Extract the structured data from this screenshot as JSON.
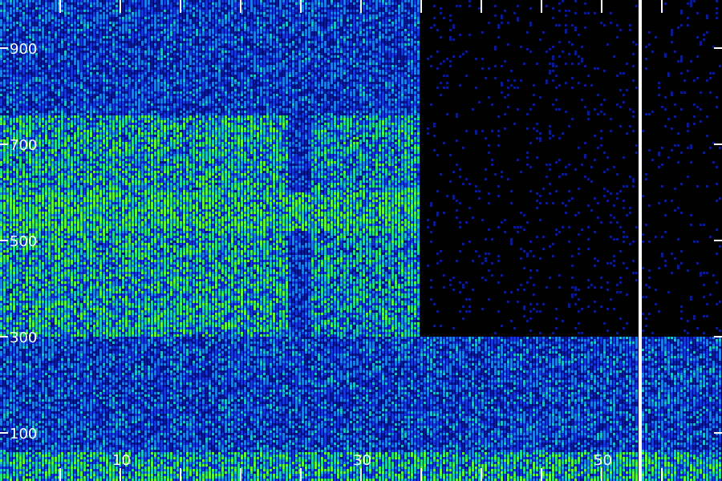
{
  "chart_data": {
    "type": "heatmap",
    "title": "",
    "xlabel": "",
    "ylabel": "",
    "x_ticks": [
      10,
      30,
      50
    ],
    "y_ticks": [
      100,
      300,
      500,
      700,
      900
    ],
    "xlim": [
      0,
      60
    ],
    "ylim": [
      0,
      1000
    ],
    "cursor_x": 53.2,
    "colormap": [
      "#000000",
      "#0a1a8c",
      "#1537d8",
      "#1a7fe6",
      "#19c3c8",
      "#22e07a",
      "#5cff3a"
    ],
    "regions": [
      {
        "x": [
          0,
          24
        ],
        "y": [
          300,
          760
        ],
        "intensity": 0.78
      },
      {
        "x": [
          24,
          26
        ],
        "y": [
          300,
          760
        ],
        "intensity": 0.45
      },
      {
        "x": [
          26,
          35
        ],
        "y": [
          300,
          760
        ],
        "intensity": 0.72
      },
      {
        "x": [
          35.5,
          60
        ],
        "y": [
          305,
          1000
        ],
        "intensity": 0.12
      },
      {
        "x": [
          0,
          35
        ],
        "y": [
          760,
          1000
        ],
        "intensity": 0.48
      },
      {
        "x": [
          0,
          60
        ],
        "y": [
          0,
          300
        ],
        "intensity": 0.5
      }
    ],
    "hot_bands": [
      {
        "y": [
          520,
          600
        ],
        "x": [
          0,
          35
        ],
        "intensity": 0.92
      },
      {
        "y": [
          0,
          60
        ],
        "x": [
          0,
          60
        ],
        "intensity": 0.8
      }
    ],
    "grid": false,
    "legend": "none"
  }
}
